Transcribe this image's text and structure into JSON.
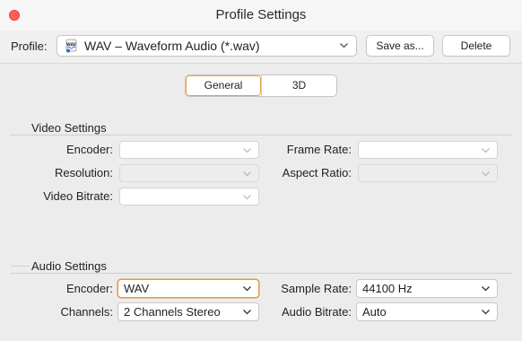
{
  "window": {
    "title": "Profile Settings"
  },
  "profile": {
    "label": "Profile:",
    "value": "WAV – Waveform Audio (*.wav)",
    "icon": "wav-file-icon",
    "save_label": "Save as...",
    "delete_label": "Delete"
  },
  "tabs": [
    {
      "label": "General",
      "selected": true
    },
    {
      "label": "3D",
      "selected": false
    }
  ],
  "video": {
    "title": "Video Settings",
    "encoder_label": "Encoder:",
    "encoder_value": "",
    "frame_rate_label": "Frame Rate:",
    "frame_rate_value": "",
    "resolution_label": "Resolution:",
    "resolution_value": "",
    "aspect_ratio_label": "Aspect Ratio:",
    "aspect_ratio_value": "",
    "bitrate_label": "Video Bitrate:",
    "bitrate_value": ""
  },
  "audio": {
    "title": "Audio Settings",
    "encoder_label": "Encoder:",
    "encoder_value": "WAV",
    "sample_rate_label": "Sample Rate:",
    "sample_rate_value": "44100 Hz",
    "channels_label": "Channels:",
    "channels_value": "2 Channels Stereo",
    "bitrate_label": "Audio Bitrate:",
    "bitrate_value": "Auto"
  },
  "colors": {
    "close": "#fd5f57",
    "focus": "#e39a3c"
  }
}
